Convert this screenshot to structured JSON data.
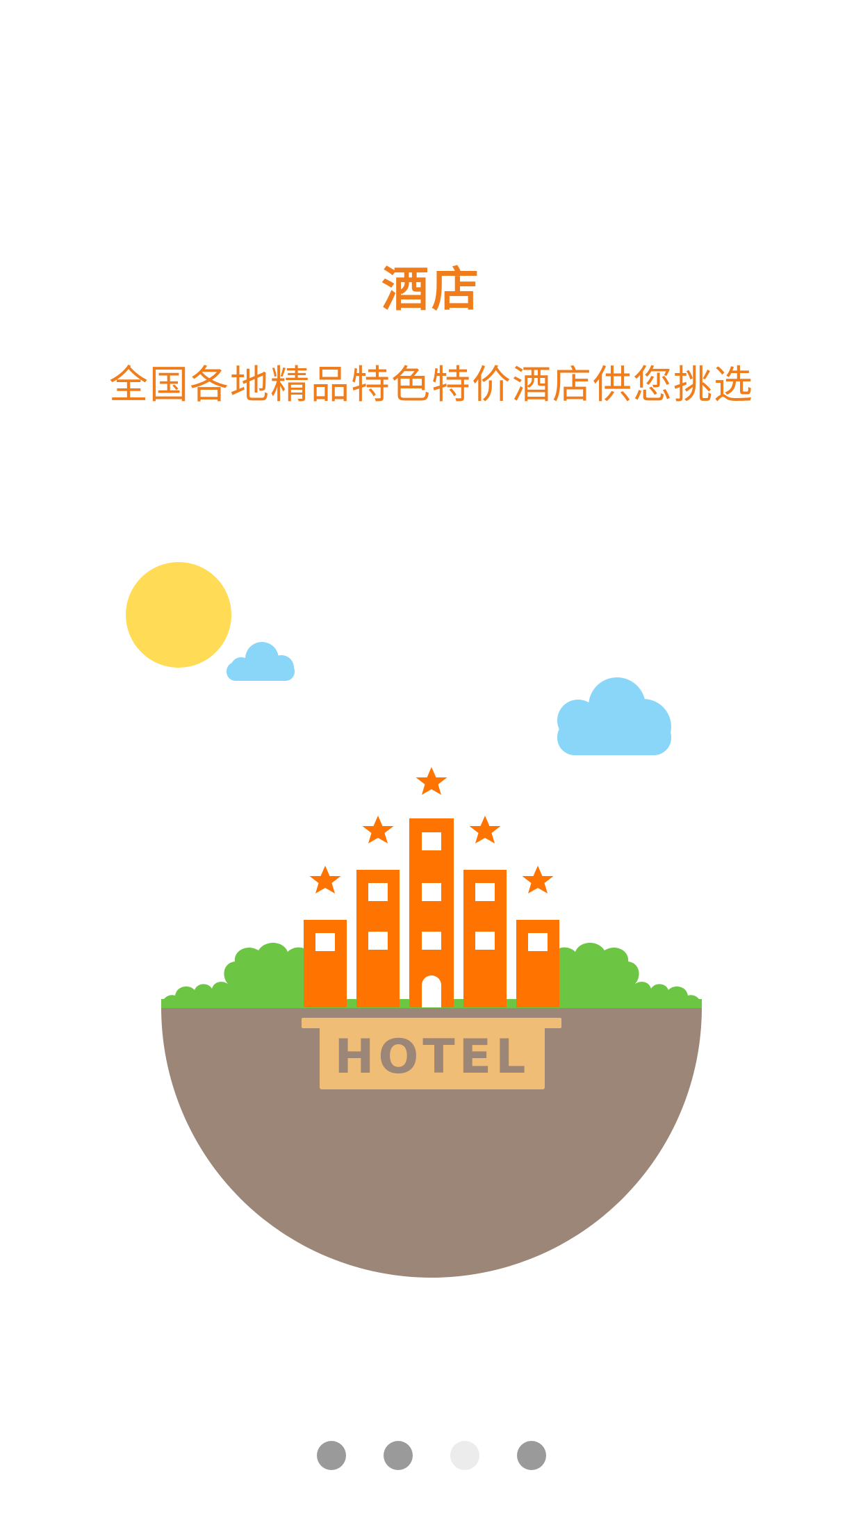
{
  "intro": {
    "title": "酒店",
    "subtitle": "全国各地精品特色特价酒店供您挑选"
  },
  "illustration": {
    "sign_text": "HOTEL",
    "colors": {
      "accent": "#f07d1b",
      "building": "#ff7301",
      "grass": "#6cc644",
      "ground": "#9b8677",
      "sign": "#f0bd76",
      "sun": "#ffdb56",
      "cloud": "#8ad6f8"
    }
  },
  "pager": {
    "count": 4,
    "active_index": 2,
    "colors": {
      "inactive": "#9a9a9a",
      "active": "#ececec"
    }
  }
}
